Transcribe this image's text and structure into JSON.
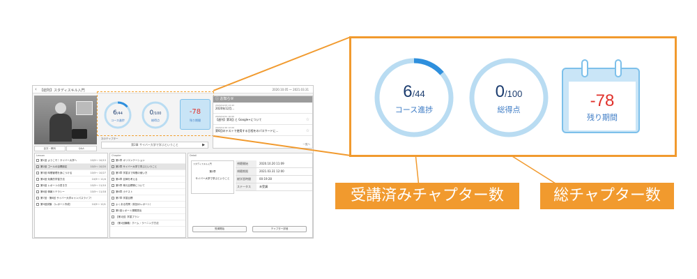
{
  "app": {
    "title": "【総則】スタディスキル入門",
    "period": "2020.10.05 ～ 2021.03.31",
    "video_tabs": [
      "目次・教科",
      "Q&A"
    ],
    "stats": {
      "progress_done": 6,
      "progress_total": "/44",
      "progress_fraction": 0.136,
      "progress_label": "コース進捗",
      "score": 0,
      "score_total": "/100",
      "score_label": "総得点",
      "remaining": "-78",
      "remaining_label": "残り期間"
    },
    "next_chapter_label": "次のチャプター",
    "next_chapter": "第2章 サイバー大学で学ぶということ",
    "notice": {
      "title": "お知らせ",
      "items": [
        {
          "date": "2020/12/03 13:43",
          "text": "2020年12月..."
        },
        {
          "date": "2020/12/01 16:00",
          "text": "【週刊】第3回 と Google+について"
        },
        {
          "date": "2020/11/16 12:00",
          "text": "第6回のテストで使用する日程をのパスワードに..."
        }
      ],
      "more": "一覧へ"
    },
    "lesson_header": "Lesson",
    "lessons": [
      {
        "title": "第1回 ようこそ！サイバー大学へ",
        "date": "10/5〜 10/13"
      },
      {
        "title": "第2回 ゴールの目標設定",
        "date": "10/5〜 10/20"
      },
      {
        "title": "第3回 時間管理を身につける",
        "date": "10/5〜 10/27"
      },
      {
        "title": "第4回 効果的学習方法",
        "date": "10/5〜 11/4"
      },
      {
        "title": "第5回 レポートの書き方",
        "date": "10/5〜 11/10"
      },
      {
        "title": "第6回 情報リテラシー",
        "date": "10/5〜 11/18"
      },
      {
        "title": "第7回・第8回 サイバー大学キャンパスライフ！",
        "date": "10/5〜 11/24"
      },
      {
        "title": "第9回試験 （レポート作成）",
        "date": "10/5〜 12/1"
      }
    ],
    "chapter_header": "Chapter",
    "chapters": [
      "第1章 オリエンテーション",
      "第2章 サイバー大学で学ぶということ",
      "第3章 学習まで時間の使い方",
      "第4章 自律を考える",
      "第5章 単元目標等について",
      "第6章 小テスト",
      "第7章 学習目標",
      "よくある質問（前回のレポート）",
      "第1回レポート課題提出",
      "【第1回】学習プラン",
      "（第1回講義）ホーム・ラーニング方法"
    ],
    "detail_header": "Detail",
    "doc_title": "スタディスキル入門",
    "doc_chapter": "第2章",
    "doc_caption": "サイバー大学で学ぶということ",
    "detail": [
      {
        "k": "視聴開始",
        "v": "2020.10.20 11:09"
      },
      {
        "k": "視聴期限",
        "v": "2021.03.31 12:00"
      },
      {
        "k": "総学習時間",
        "v": "00:19:28"
      },
      {
        "k": "ステータス",
        "v": "未受講"
      }
    ],
    "detail_buttons": [
      "受講開始",
      "チャプター詳細"
    ]
  },
  "zoom": {
    "progress_done": "6",
    "progress_total": "/44",
    "progress_fraction": 0.136,
    "progress_label": "コース進捗",
    "score": "0",
    "score_total": "/100",
    "score_fraction": 0,
    "score_label": "総得点",
    "remaining": "-78",
    "remaining_label": "残り期間"
  },
  "annotations": {
    "done_label": "受講済みチャプター数",
    "total_label": "総チャプター数"
  },
  "colors": {
    "accent_orange": "#f19a2e",
    "ring_track": "#b9dcf2",
    "ring_fill": "#2e8fdd",
    "number_navy": "#1a3b6e",
    "label_blue": "#3e7cc5",
    "remaining_red": "#e0312b"
  }
}
